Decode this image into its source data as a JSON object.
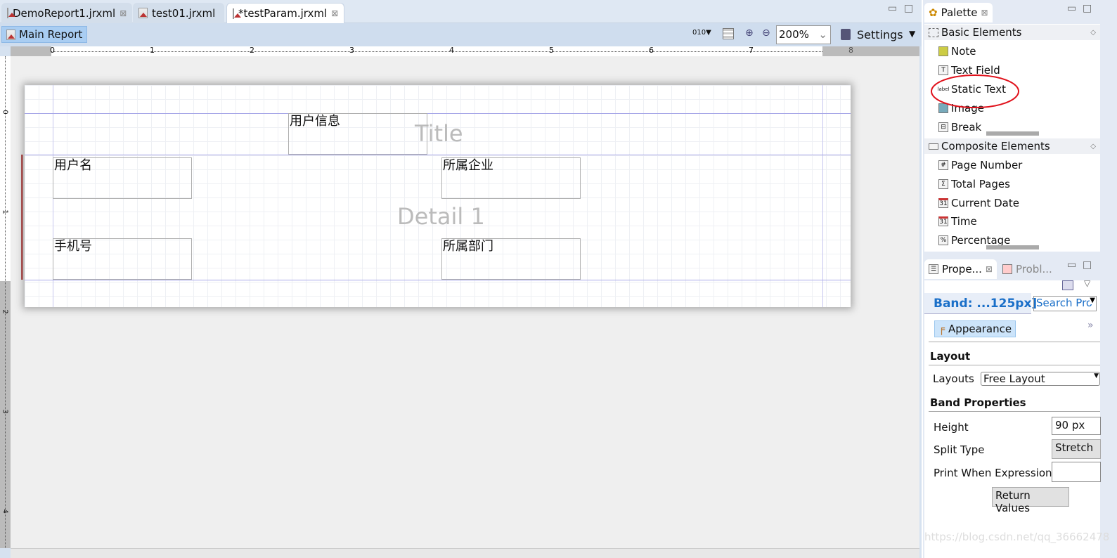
{
  "tabs": [
    {
      "label": "DemoReport1.jrxml",
      "closable": true
    },
    {
      "label": "test01.jrxml",
      "closable": false
    },
    {
      "label": "*testParam.jrxml",
      "closable": true,
      "active": true
    }
  ],
  "toolbar": {
    "main_report": "Main Report",
    "zoom": "200%",
    "settings": "Settings"
  },
  "ruler": {
    "ticks": [
      "0",
      "1",
      "2",
      "3",
      "4",
      "5",
      "6",
      "7",
      "8"
    ],
    "vticks": [
      "0",
      "1",
      "2",
      "3",
      "4"
    ]
  },
  "report": {
    "title_band": "Title",
    "detail_band": "Detail 1",
    "elements": {
      "title_text": "用户信息",
      "username": "用户名",
      "company": "所属企业",
      "phone": "手机号",
      "department": "所属部门"
    }
  },
  "palette": {
    "title": "Palette",
    "basic_section": "Basic Elements",
    "basic_items": [
      {
        "label": "Note",
        "icon": "note-icon"
      },
      {
        "label": "Text Field",
        "icon": "text-field-icon"
      },
      {
        "label": "Static Text",
        "icon": "label-icon"
      },
      {
        "label": "Image",
        "icon": "image-icon"
      },
      {
        "label": "Break",
        "icon": "break-icon"
      }
    ],
    "composite_section": "Composite Elements",
    "composite_items": [
      {
        "label": "Page Number",
        "icon": "#"
      },
      {
        "label": "Total Pages",
        "icon": "Σ"
      },
      {
        "label": "Current Date",
        "icon": "31"
      },
      {
        "label": "Time",
        "icon": "31"
      },
      {
        "label": "Percentage",
        "icon": "%"
      }
    ],
    "annotation_color": "#e0101a"
  },
  "properties": {
    "tab": "Prope...",
    "problems_tab": "Probl...",
    "band_title": "Band: ...125px]",
    "search_placeholder": "Search Pro",
    "appearance": "Appearance",
    "layout_section": "Layout",
    "layouts_label": "Layouts",
    "layouts_value": "Free Layout",
    "band_section": "Band Properties",
    "height_label": "Height",
    "height_value": "90 px",
    "split_label": "Split Type",
    "split_value": "Stretch",
    "print_when_label": "Print When Expression",
    "print_when_value": "",
    "return_values": "Return Values"
  },
  "watermark": "https://blog.csdn.net/qq_36662478"
}
